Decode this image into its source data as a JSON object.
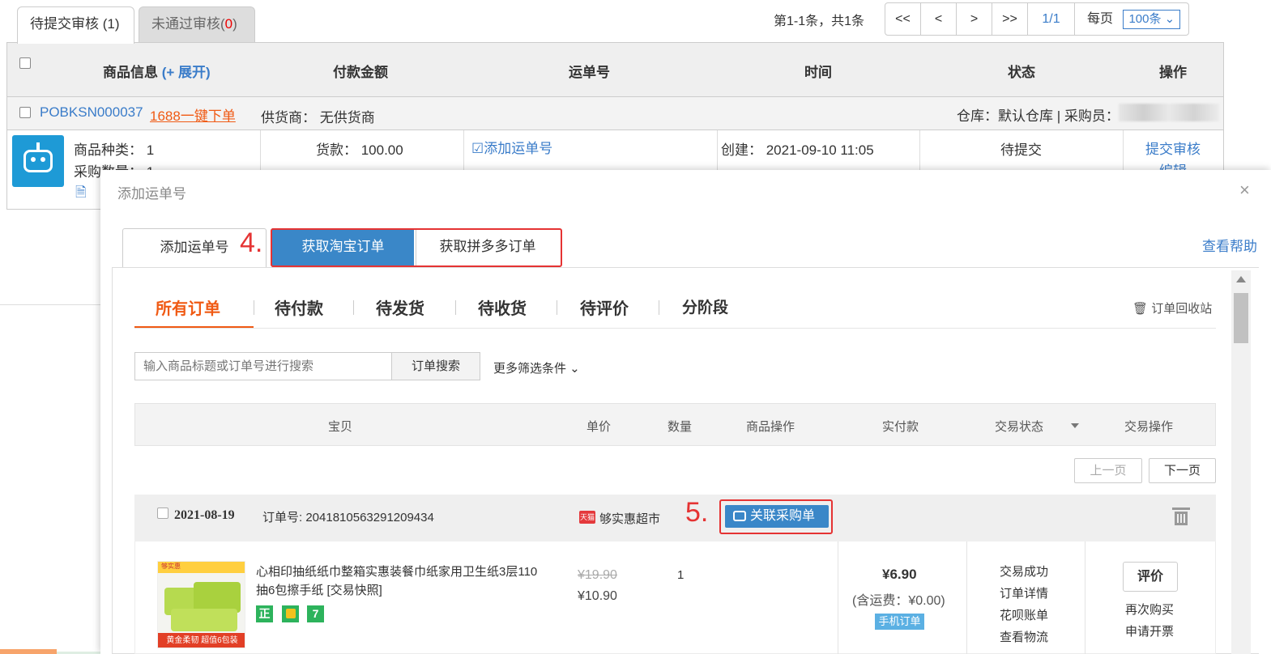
{
  "top_tabs": [
    {
      "label": "待提交审核",
      "count": "(1)"
    },
    {
      "label": "未通过审核",
      "count_open": "(",
      "count": "0",
      "count_close": ")"
    }
  ],
  "pager": {
    "info": "第1-1条，共1条",
    "first": "<<",
    "prev": "<",
    "next": ">",
    "last": ">>",
    "current": "1/1",
    "per_page_label": "每页",
    "per_page_value": "100条"
  },
  "table_header": {
    "product_info": "商品信息",
    "expand": "(+ 展开)",
    "payment": "付款金额",
    "waybill": "运单号",
    "time": "时间",
    "status": "状态",
    "action": "操作"
  },
  "purchase_order": {
    "id": "POBKSN000037",
    "one_click_label": "1688一键下单",
    "supplier": "供货商：  无供货商",
    "warehouse": "仓库：默认仓库 | 采购员：",
    "product_types": "商品种类：  1",
    "purchase_qty": "采购数量：  1",
    "goods_price": "货款：  100.00",
    "add_waybill": "添加运单号",
    "created": "创建：  2021-09-10 11:05",
    "status": "待提交",
    "submit_review": "提交审核",
    "edit": "编辑"
  },
  "modal": {
    "title": "添加运单号",
    "close": "×",
    "help": "查看帮助",
    "tabs": [
      "添加运单号",
      "获取淘宝订单",
      "获取拼多多订单"
    ],
    "step4": "4.",
    "step5": "5.",
    "order_tabs": [
      "所有订单",
      "待付款",
      "待发货",
      "待收货",
      "待评价",
      "分阶段"
    ],
    "recycle": "订单回收站",
    "search_placeholder": "输入商品标题或订单号进行搜索",
    "search_button": "订单搜索",
    "more_filters": "更多筛选条件 ⌄",
    "columns": {
      "item": "宝贝",
      "unit_price": "单价",
      "qty": "数量",
      "item_ops": "商品操作",
      "paid": "实付款",
      "trade_status": "交易状态",
      "trade_ops": "交易操作"
    },
    "prev_page": "上一页",
    "next_page": "下一页",
    "order": {
      "date": "2021-08-19",
      "number": "订单号: 2041810563291209434",
      "shop_badge": "天猫",
      "shop": "够实惠超市",
      "link_button": "关联采购单",
      "title": "心相印抽纸纸巾整箱实惠装餐巾纸家用卫生纸3层110抽6包擦手纸 [交易快照]",
      "badges": [
        "正",
        "",
        "7"
      ],
      "old_price": "¥19.90",
      "price": "¥10.90",
      "qty": "1",
      "paid": "¥6.90",
      "shipping": "(含运费：¥0.00)",
      "mobile_order": "手机订单",
      "status_links": [
        "交易成功",
        "订单详情",
        "花呗账单",
        "查看物流"
      ],
      "review": "评价",
      "actions": [
        "再次购买",
        "申请开票"
      ],
      "img_top": "够实惠",
      "img_bottom": "黄金柔韧 超值6包装"
    }
  },
  "colors": {
    "accent_blue": "#3a87c8",
    "link_blue": "#3a7cc9",
    "orange": "#f05a14",
    "annotation_red": "#e53333"
  }
}
